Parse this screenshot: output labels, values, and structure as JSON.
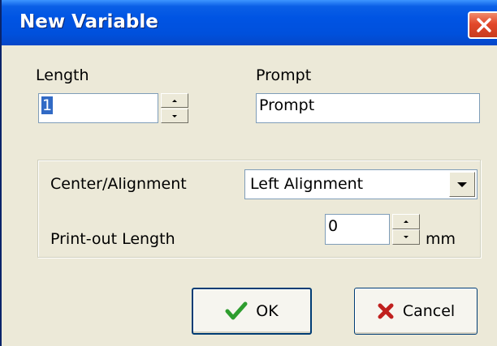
{
  "window": {
    "title": "New Variable"
  },
  "length": {
    "label": "Length",
    "value": "1"
  },
  "prompt": {
    "label": "Prompt",
    "value": "Prompt"
  },
  "alignment": {
    "label": "Center/Alignment",
    "selected": "Left Alignment"
  },
  "printout": {
    "label": "Print-out Length",
    "value": "0",
    "unit": "mm"
  },
  "buttons": {
    "ok_label": "OK",
    "cancel_label": "Cancel"
  },
  "icons": {
    "close": "close-icon",
    "ok": "checkmark-icon",
    "cancel": "x-icon",
    "spin_up": "arrow-up-icon",
    "spin_down": "arrow-down-icon",
    "dropdown": "chevron-down-icon"
  },
  "colors": {
    "titlebar": "#0054e3",
    "close_button": "#e2482b",
    "selection": "#316ac5",
    "ok_check": "#2e9d2e",
    "cancel_x": "#c0201e",
    "dialog_bg": "#ece9d8"
  }
}
